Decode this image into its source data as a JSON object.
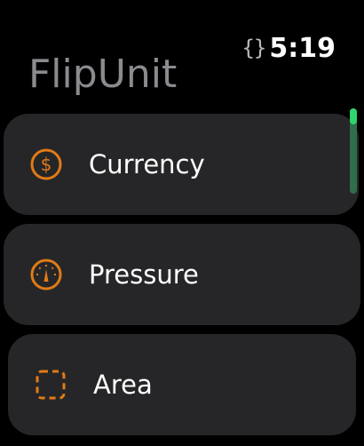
{
  "status_bar": {
    "complication_glyph": "{}",
    "time": "5:19"
  },
  "app": {
    "title": "FlipUnit"
  },
  "list": {
    "items": [
      {
        "label": "Currency",
        "icon": "dollar-circle-icon"
      },
      {
        "label": "Pressure",
        "icon": "gauge-icon"
      },
      {
        "label": "Area",
        "icon": "dashed-square-icon"
      }
    ]
  },
  "scroll_indicator": {
    "position_fraction": 0.0
  },
  "colors": {
    "background": "#000000",
    "row_background": "#262628",
    "accent_icon": "#e07b16",
    "title": "#8a8a8f",
    "scroll_thumb": "#2fd46e",
    "scroll_track": "#2e6e4a"
  }
}
